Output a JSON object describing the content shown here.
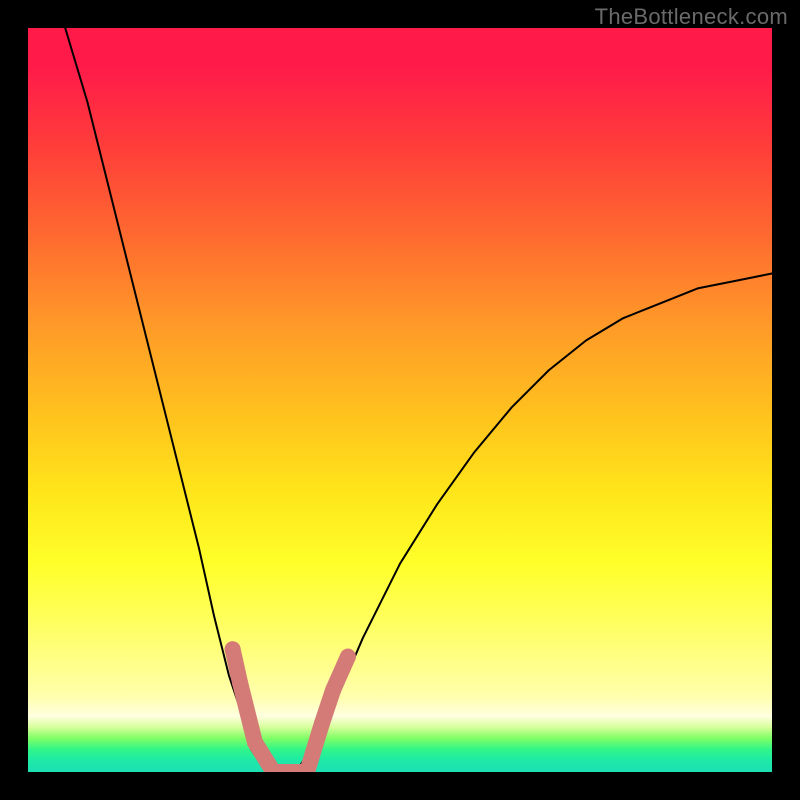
{
  "watermark": "TheBottleneck.com",
  "chart_data": {
    "type": "line",
    "title": "",
    "xlabel": "",
    "ylabel": "",
    "x": [
      0.05,
      0.08,
      0.11,
      0.14,
      0.17,
      0.2,
      0.23,
      0.25,
      0.27,
      0.29,
      0.3,
      0.32,
      0.34,
      0.36,
      0.4,
      0.42,
      0.45,
      0.5,
      0.55,
      0.6,
      0.65,
      0.7,
      0.75,
      0.8,
      0.85,
      0.9,
      0.95,
      1.0
    ],
    "values": [
      1.0,
      0.9,
      0.78,
      0.66,
      0.54,
      0.42,
      0.3,
      0.21,
      0.13,
      0.07,
      0.03,
      0.0,
      0.0,
      0.0,
      0.06,
      0.11,
      0.18,
      0.28,
      0.36,
      0.43,
      0.49,
      0.54,
      0.58,
      0.61,
      0.63,
      0.65,
      0.66,
      0.67
    ],
    "xlim": [
      0,
      1
    ],
    "ylim": [
      0,
      1
    ],
    "legend": false,
    "grid": false,
    "markers": {
      "x": [
        0.275,
        0.285,
        0.305,
        0.33,
        0.355,
        0.375,
        0.395,
        0.41,
        0.43
      ],
      "y": [
        0.165,
        0.12,
        0.04,
        0.0,
        0.0,
        0.0,
        0.065,
        0.11,
        0.155
      ],
      "color": "#d47a77",
      "size": 16
    },
    "gradient_background": true,
    "curve_color": "#000000"
  }
}
